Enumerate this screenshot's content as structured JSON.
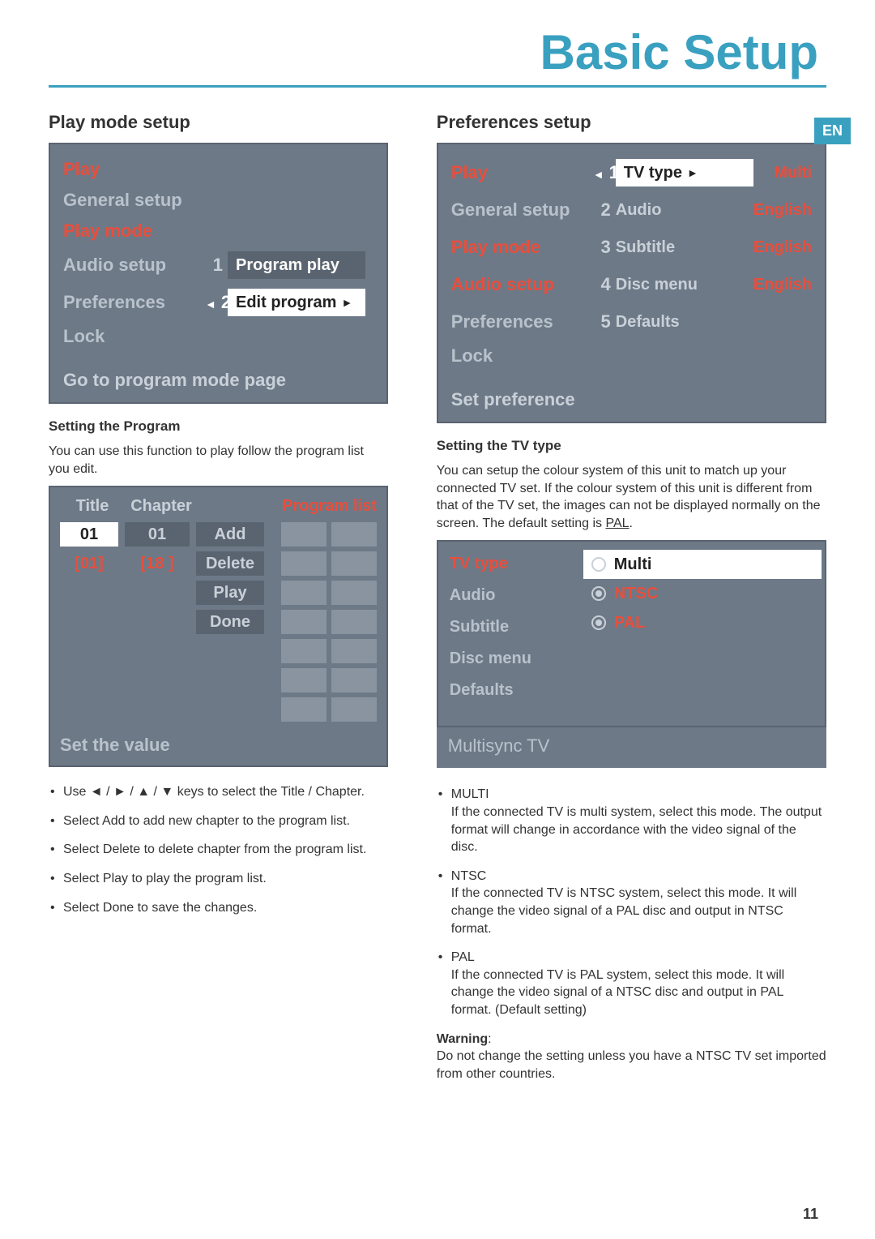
{
  "header": {
    "title": "Basic Setup",
    "lang_tab": "EN"
  },
  "left": {
    "section_title": "Play mode setup",
    "menu": {
      "items_inactive": [
        "General setup",
        "Audio setup",
        "Preferences",
        "Lock"
      ],
      "item_active_top": "Play",
      "item_active_mid": "Play mode",
      "option1_num": "1",
      "option1_label": "Program play",
      "option2_num": "2",
      "option2_label": "Edit program",
      "footer": "Go to program mode page"
    },
    "sub1_head": "Setting the Program",
    "sub1_body": "You can use this function to play follow the program list you edit.",
    "prog": {
      "h_title": "Title",
      "h_chapter": "Chapter",
      "h_list": "Program list",
      "title_top": "01",
      "title_sel": "[01]",
      "ch_top": "01",
      "ch_sel": "[18 ]",
      "btn_add": "Add",
      "btn_delete": "Delete",
      "btn_play": "Play",
      "btn_done": "Done",
      "footer": "Set the value"
    },
    "bullets": [
      "Use ◄ / ► / ▲ / ▼  keys to select the Title / Chapter.",
      "Select Add to add new chapter to the program list.",
      "Select Delete to delete chapter from the program list.",
      "Select Play to play the program list.",
      "Select Done to save the changes."
    ]
  },
  "right": {
    "section_title": "Preferences setup",
    "menu": {
      "sidebar": [
        "Play",
        "General setup",
        "Play mode",
        "Audio setup",
        "Preferences",
        "Lock"
      ],
      "sidebar_active_idx": 0,
      "sidebar_highlight_idx": 4,
      "rows": [
        {
          "num": "1",
          "label": "TV type",
          "value": "Multi",
          "hl": true
        },
        {
          "num": "2",
          "label": "Audio",
          "value": "English"
        },
        {
          "num": "3",
          "label": "Subtitle",
          "value": "English"
        },
        {
          "num": "4",
          "label": "Disc menu",
          "value": "English"
        },
        {
          "num": "5",
          "label": "Defaults",
          "value": ""
        }
      ],
      "footer": "Set preference"
    },
    "sub1_head": "Setting the TV type",
    "sub1_body_a": "You can setup the colour system of this unit to match up your connected TV set. If the colour system of this unit is different from that of the TV set, the images can not be displayed normally on the screen. The default setting is ",
    "sub1_body_b": "PAL",
    "sub1_body_c": ".",
    "tvbox": {
      "left": [
        "TV type",
        "Audio",
        "Subtitle",
        "Disc menu",
        "Defaults"
      ],
      "opts": [
        "Multi",
        "NTSC",
        "PAL"
      ],
      "footer": "Multisync TV"
    },
    "bullets": [
      {
        "title": "MULTI",
        "desc": "If the connected TV is multi system, select this mode. The output format will change in accordance with the video signal of the disc."
      },
      {
        "title": "NTSC",
        "desc": "If the connected TV is NTSC system, select this mode. It will change the video signal of a PAL disc and output in NTSC format."
      },
      {
        "title": "PAL",
        "desc": "If the connected TV is PAL system, select this mode. It will change the video signal of a NTSC disc and output in PAL format. (Default setting)"
      }
    ],
    "warning_head": "Warning",
    "warning_body": "Do not change the setting unless you have a NTSC TV set imported from other countries."
  },
  "page_number": "11"
}
